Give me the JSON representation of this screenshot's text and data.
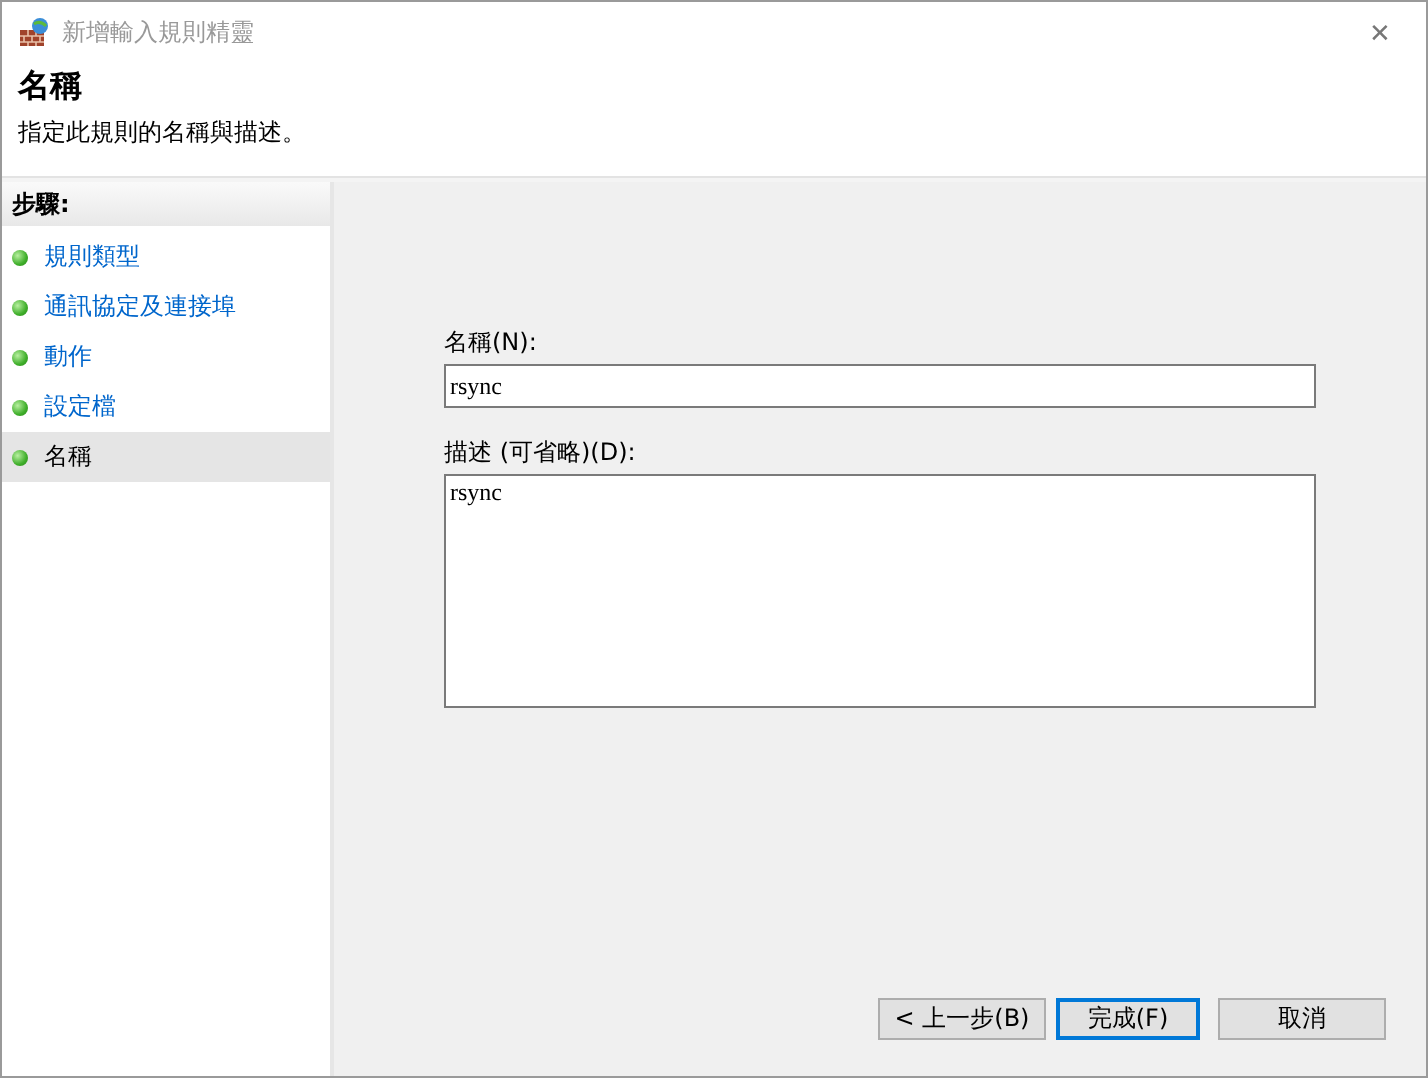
{
  "window": {
    "title": "新增輸入規則精靈",
    "close": "✕"
  },
  "header": {
    "title": "名稱",
    "subtitle": "指定此規則的名稱與描述。"
  },
  "steps": {
    "heading": "步驟:",
    "items": [
      {
        "label": "規則類型",
        "selected": false
      },
      {
        "label": "通訊協定及連接埠",
        "selected": false
      },
      {
        "label": "動作",
        "selected": false
      },
      {
        "label": "設定檔",
        "selected": false
      },
      {
        "label": "名稱",
        "selected": true
      }
    ]
  },
  "form": {
    "name_label": "名稱(N):",
    "name_value": "rsync",
    "description_label": "描述 (可省略)(D):",
    "description_value": "rsync"
  },
  "buttons": [
    {
      "label": "< 上一步(B)",
      "default": false
    },
    {
      "label": "完成(F)",
      "default": true
    },
    {
      "label": "取消",
      "default": false
    }
  ]
}
